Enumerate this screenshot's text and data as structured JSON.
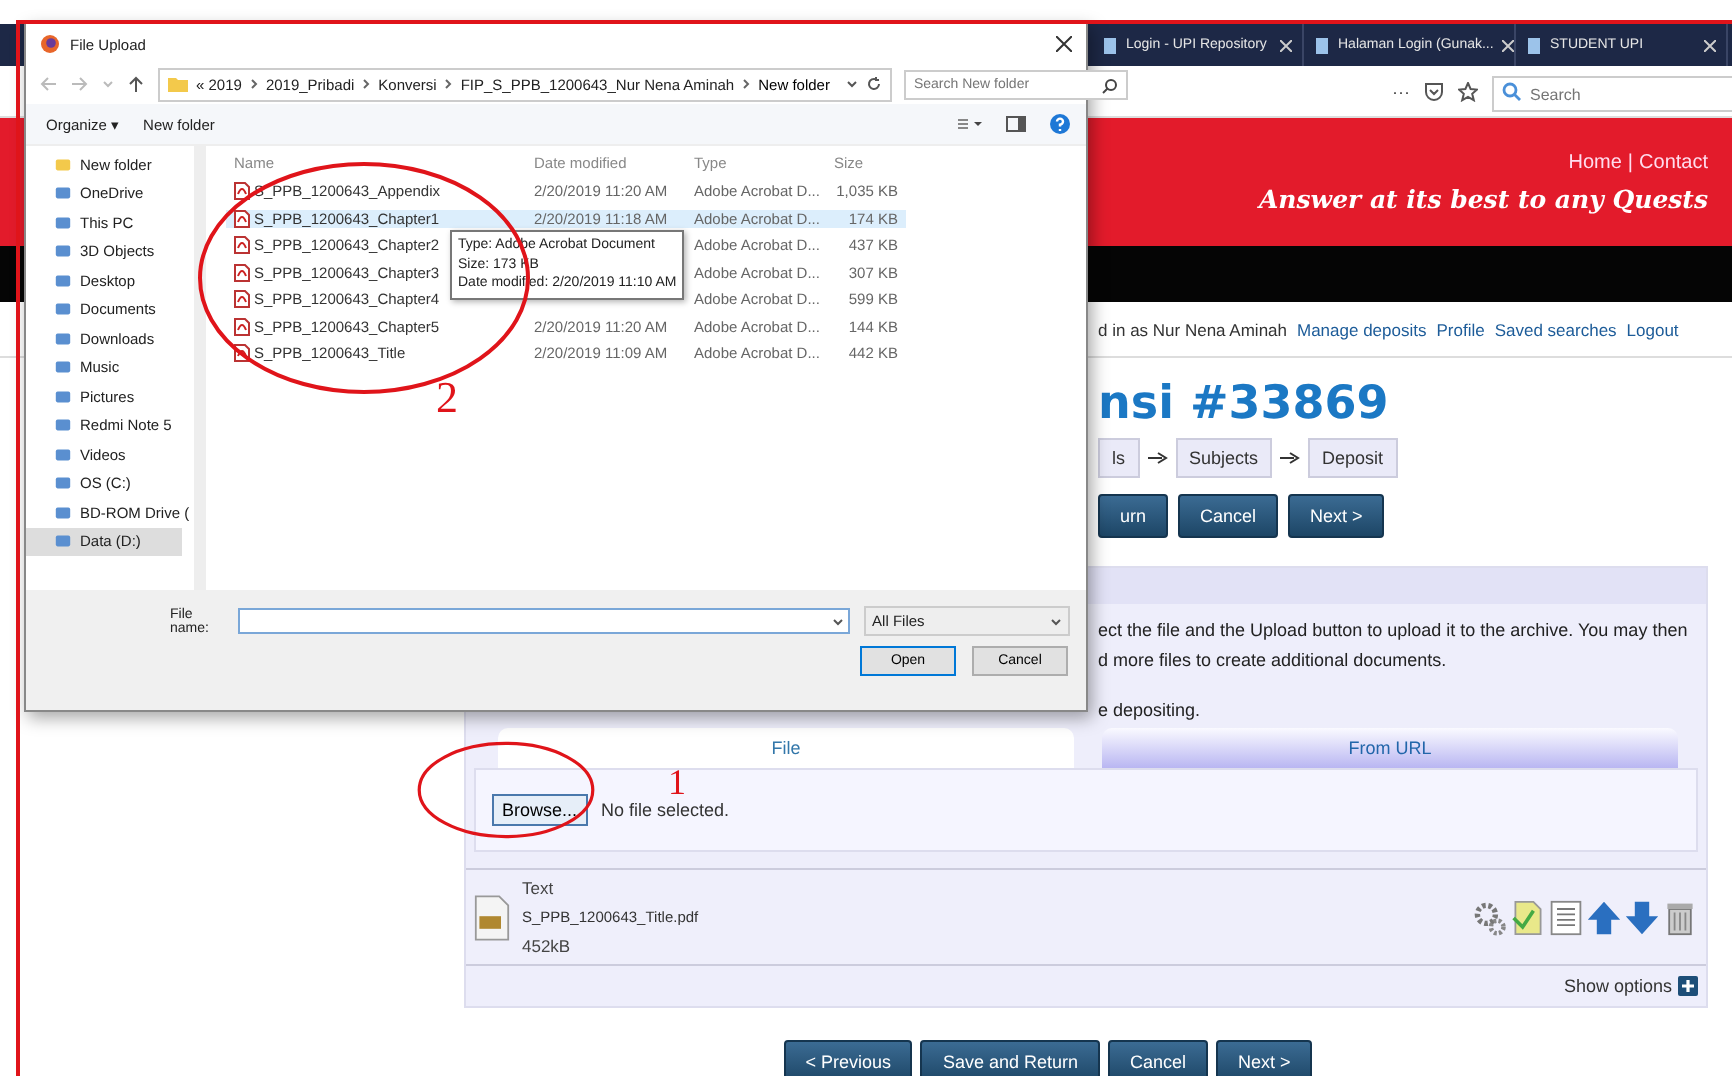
{
  "browser": {
    "tabs": [
      {
        "title": "Login - UPI Repository"
      },
      {
        "title": "Halaman Login (Gunak..."
      },
      {
        "title": "STUDENT UPI"
      }
    ],
    "menu": "···",
    "search_placeholder": "Search"
  },
  "site": {
    "header_links": [
      "Home",
      "Contact"
    ],
    "link_separator": "|",
    "tagline": "Answer at its best to any Quests"
  },
  "user_bar": {
    "greeting": "d in as Nur Nena Aminah",
    "links": [
      "Manage deposits",
      "Profile",
      "Saved searches",
      "Logout"
    ]
  },
  "page_title": "nsi #33869",
  "steps": [
    "ls",
    "Subjects",
    "Deposit"
  ],
  "top_buttons": [
    "urn",
    "Cancel",
    "Next >"
  ],
  "upload": {
    "instructions": [
      "ect the file and the Upload button to upload it to the archive. You may then",
      "d more files to create additional documents."
    ],
    "note": "e depositing.",
    "tabs": [
      {
        "label": "File",
        "selected": true
      },
      {
        "label": "From URL",
        "selected": false
      }
    ],
    "browse_button": "Browse...",
    "no_file": "No file selected.",
    "documents": [
      {
        "type": "Text",
        "filename": "S_PPB_1200643_Title.pdf",
        "size": "452kB"
      }
    ],
    "show_options": "Show options"
  },
  "bottom_buttons": [
    "< Previous",
    "Save and Return",
    "Cancel",
    "Next >"
  ],
  "dialog": {
    "title": "File Upload",
    "breadcrumb": [
      "« 2019",
      "2019_Pribadi",
      "Konversi",
      "FIP_S_PPB_1200643_Nur Nena Aminah",
      "New folder"
    ],
    "search_placeholder": "Search New folder",
    "organize": "Organize ▾",
    "new_folder": "New folder",
    "nav": [
      {
        "label": "New folder",
        "selected": false
      },
      {
        "label": "OneDrive",
        "selected": false
      },
      {
        "label": "This PC",
        "selected": false
      },
      {
        "label": "3D Objects",
        "selected": false
      },
      {
        "label": "Desktop",
        "selected": false
      },
      {
        "label": "Documents",
        "selected": false
      },
      {
        "label": "Downloads",
        "selected": false
      },
      {
        "label": "Music",
        "selected": false
      },
      {
        "label": "Pictures",
        "selected": false
      },
      {
        "label": "Redmi Note 5",
        "selected": false
      },
      {
        "label": "Videos",
        "selected": false
      },
      {
        "label": "OS (C:)",
        "selected": false
      },
      {
        "label": "BD-ROM Drive (",
        "selected": false
      },
      {
        "label": "Data (D:)",
        "selected": true
      }
    ],
    "columns": [
      "Name",
      "Date modified",
      "Type",
      "Size"
    ],
    "files": [
      {
        "name": "S_PPB_1200643_Appendix",
        "date": "2/20/2019 11:20 AM",
        "type": "Adobe Acrobat D...",
        "size": "1,035 KB",
        "selected": false
      },
      {
        "name": "S_PPB_1200643_Chapter1",
        "date": "2/20/2019 11:18 AM",
        "type": "Adobe Acrobat D...",
        "size": "174 KB",
        "selected": true
      },
      {
        "name": "S_PPB_1200643_Chapter2",
        "type": "Adobe Acrobat D...",
        "size": "437 KB",
        "selected": false
      },
      {
        "name": "S_PPB_1200643_Chapter3",
        "type": "Adobe Acrobat D...",
        "size": "307 KB",
        "selected": false
      },
      {
        "name": "S_PPB_1200643_Chapter4",
        "type": "Adobe Acrobat D...",
        "size": "599 KB",
        "selected": false
      },
      {
        "name": "S_PPB_1200643_Chapter5",
        "date": "2/20/2019 11:20 AM",
        "type": "Adobe Acrobat D...",
        "size": "144 KB",
        "selected": false
      },
      {
        "name": "S_PPB_1200643_Title",
        "date": "2/20/2019 11:09 AM",
        "type": "Adobe Acrobat D...",
        "size": "442 KB",
        "selected": false
      }
    ],
    "tooltip": [
      "Type: Adobe Acrobat Document",
      "Size: 173 KB",
      "Date modified: 2/20/2019 11:10 AM"
    ],
    "file_name_label": "File name:",
    "filter": "All Files",
    "open_button": "Open",
    "cancel_button": "Cancel"
  },
  "annotations": [
    {
      "label": "1"
    },
    {
      "label": "2"
    }
  ]
}
